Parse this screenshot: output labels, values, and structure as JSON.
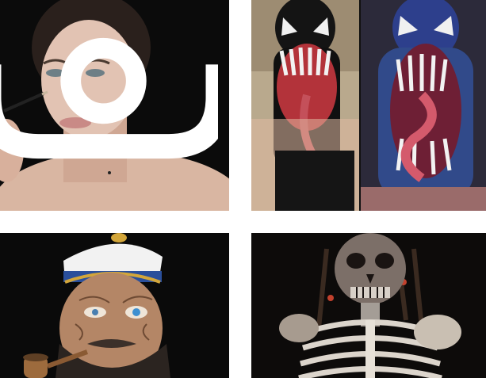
{
  "grid": {
    "background": "#ffffff",
    "tiles": [
      {
        "subject": "woman-applying-makeup",
        "icons": [
          "camera-badge-icon"
        ]
      },
      {
        "subject": "venom-bodypaint-pair"
      },
      {
        "subject": "sailor-old-man-bodypaint"
      },
      {
        "subject": "skeleton-pirate-bodypaint"
      }
    ]
  }
}
